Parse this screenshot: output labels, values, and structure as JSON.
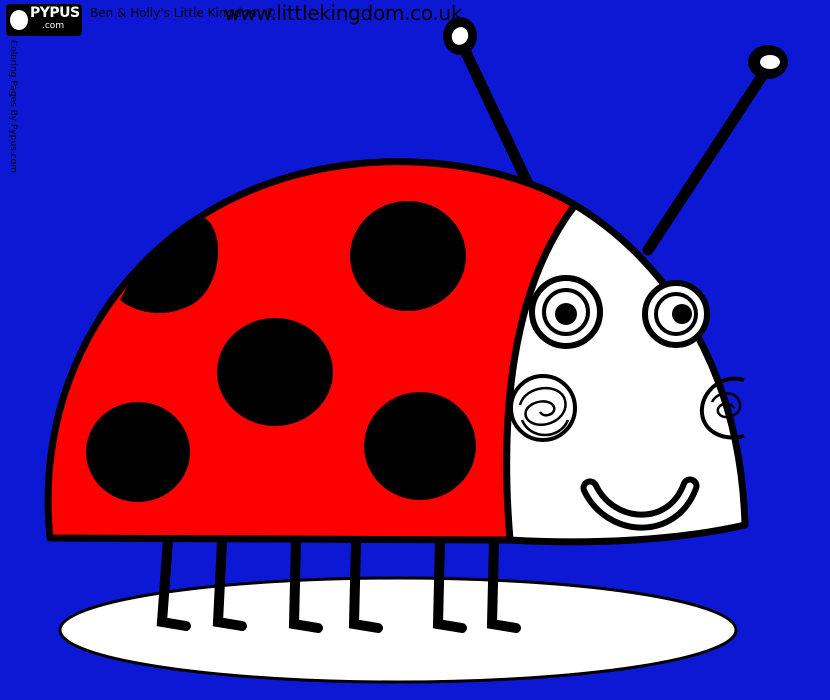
{
  "branding": {
    "logo_text": "PYPUS",
    "logo_sub": ".com",
    "caption": "Ben & Holly's Little Kingdom ©",
    "url": "www.littlekingdom.co.uk",
    "side_text": "Coloring Pages By Pypus.com"
  },
  "colors": {
    "background": "#0d18d4",
    "shell": "#ff0000",
    "face": "#ffffff",
    "outline": "#000000",
    "shadow": "#ffffff"
  },
  "illustration": {
    "subject": "ladybird"
  }
}
